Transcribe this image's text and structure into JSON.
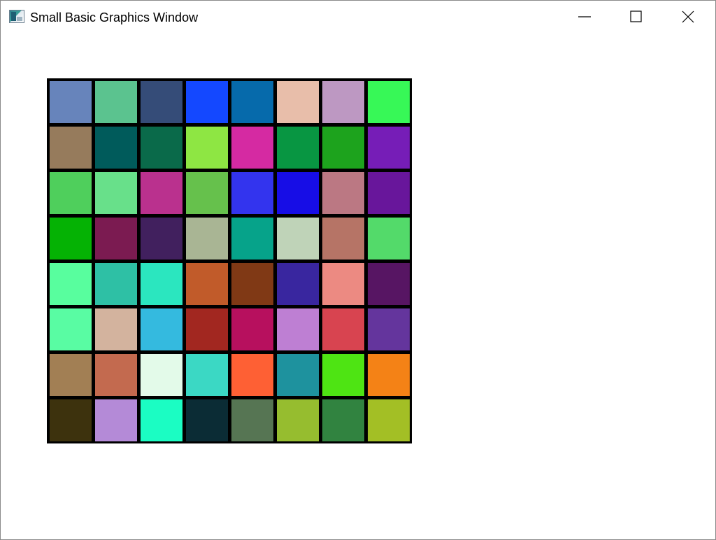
{
  "window": {
    "title": "Small Basic Graphics Window",
    "icon": "small-basic-app-icon"
  },
  "caption_buttons": {
    "minimize_icon": "minimize-icon",
    "maximize_icon": "maximize-icon",
    "close_icon": "close-icon"
  },
  "grid": {
    "rows": 8,
    "cols": 8,
    "border_color": "#000000",
    "colors": [
      [
        "#6784BB",
        "#5BC38F",
        "#354C78",
        "#1448FF",
        "#066AAB",
        "#E8BEAA",
        "#BD98C2",
        "#37F857"
      ],
      [
        "#967B5C",
        "#005B5B",
        "#0A6A4A",
        "#8EE643",
        "#D52AA2",
        "#089642",
        "#1DA31D",
        "#761DB7"
      ],
      [
        "#4FCF5C",
        "#68E08A",
        "#BA318E",
        "#66C14C",
        "#3334EE",
        "#170DE6",
        "#BB7883",
        "#68169B"
      ],
      [
        "#05B204",
        "#7B1B51",
        "#41205E",
        "#A9B594",
        "#06A38A",
        "#BFD3B8",
        "#B67466",
        "#53DA6A"
      ],
      [
        "#58FE9E",
        "#2EC0A5",
        "#2BE6BF",
        "#C15B2A",
        "#803915",
        "#39269F",
        "#EC8A82",
        "#571563"
      ],
      [
        "#59FCA3",
        "#D3B39E",
        "#34BADF",
        "#A22720",
        "#B7105E",
        "#BE7FD3",
        "#D84450",
        "#64359D"
      ],
      [
        "#A27F54",
        "#C36A4F",
        "#E3FAE9",
        "#3BD8C4",
        "#FE6034",
        "#1E929E",
        "#4EE413",
        "#F48216"
      ],
      [
        "#3D320D",
        "#B48AD7",
        "#1BFDC3",
        "#0B2C35",
        "#567553",
        "#96BD2F",
        "#318340",
        "#A3BF25"
      ]
    ]
  }
}
